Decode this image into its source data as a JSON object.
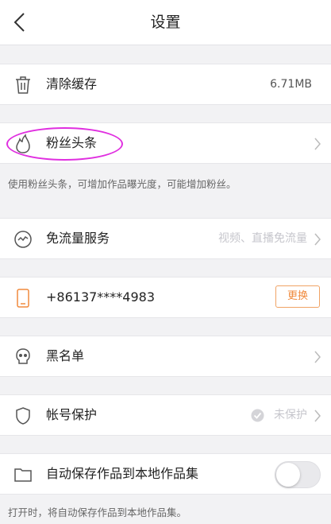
{
  "header": {
    "title": "设置"
  },
  "settings": {
    "clear_cache": {
      "label": "清除缓存",
      "value": "6.71MB"
    },
    "fans_headline": {
      "label": "粉丝头条",
      "note": "使用粉丝头条，可增加作品曝光度，可能增加粉丝。"
    },
    "free_data": {
      "label": "免流量服务",
      "value": "视频、直播免流量"
    },
    "phone": {
      "label": "+86137****4983",
      "button": "更换"
    },
    "blacklist": {
      "label": "黑名单"
    },
    "account_protect": {
      "label": "帐号保护",
      "value": "未保护"
    },
    "auto_save": {
      "label": "自动保存作品到本地作品集",
      "note": "打开时，将自动保存作品到本地作品集。",
      "enabled": false
    }
  },
  "colors": {
    "accent": "#f08a3d",
    "annotation": "#e02fe0",
    "background": "#f2f2f4"
  },
  "icons": [
    "back-arrow-icon",
    "trash-icon",
    "flame-icon",
    "wave-icon",
    "phone-icon",
    "skull-icon",
    "shield-icon",
    "folder-icon",
    "check-circle-icon",
    "chevron-right-icon"
  ]
}
